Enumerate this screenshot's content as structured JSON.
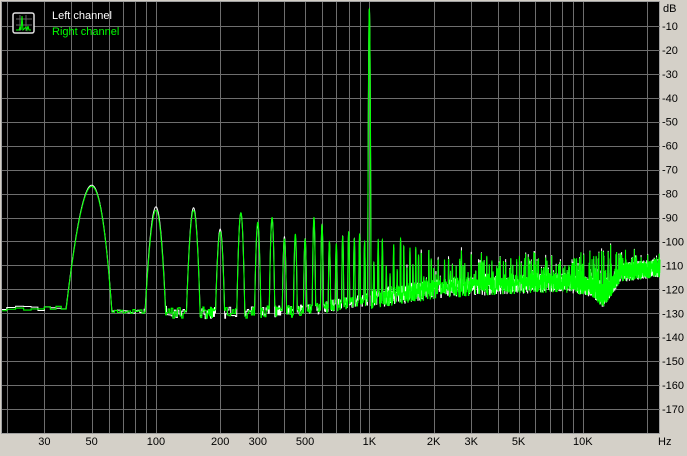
{
  "chart_data": {
    "type": "line",
    "title": "",
    "xlabel": "Hz",
    "ylabel": "dB",
    "xscale": "log",
    "xlim": [
      19,
      23000
    ],
    "ylim": [
      -180,
      0
    ],
    "grid": true,
    "legend_position": "top-left",
    "x_tick_labels": [
      {
        "value": 30,
        "label": "30"
      },
      {
        "value": 50,
        "label": "50"
      },
      {
        "value": 100,
        "label": "100"
      },
      {
        "value": 200,
        "label": "200"
      },
      {
        "value": 300,
        "label": "300"
      },
      {
        "value": 500,
        "label": "500"
      },
      {
        "value": 1000,
        "label": "1K"
      },
      {
        "value": 2000,
        "label": "2K"
      },
      {
        "value": 3000,
        "label": "3K"
      },
      {
        "value": 5000,
        "label": "5K"
      },
      {
        "value": 10000,
        "label": "10K"
      }
    ],
    "y_tick_labels": [
      {
        "value": -10,
        "label": "-10"
      },
      {
        "value": -20,
        "label": "-20"
      },
      {
        "value": -30,
        "label": "-30"
      },
      {
        "value": -40,
        "label": "-40"
      },
      {
        "value": -50,
        "label": "-50"
      },
      {
        "value": -60,
        "label": "-60"
      },
      {
        "value": -70,
        "label": "-70"
      },
      {
        "value": -80,
        "label": "-80"
      },
      {
        "value": -90,
        "label": "-90"
      },
      {
        "value": -100,
        "label": "-100"
      },
      {
        "value": -110,
        "label": "-110"
      },
      {
        "value": -120,
        "label": "-120"
      },
      {
        "value": -130,
        "label": "-130"
      },
      {
        "value": -140,
        "label": "-140"
      },
      {
        "value": -150,
        "label": "-150"
      },
      {
        "value": -160,
        "label": "-160"
      },
      {
        "value": -170,
        "label": "-170"
      }
    ],
    "fundamental": {
      "freq": 1000,
      "level": -3
    },
    "harmonic_spacing_hz": 50,
    "harmonic_peaks": [
      [
        50,
        -77
      ],
      [
        100,
        -87
      ],
      [
        150,
        -87
      ],
      [
        200,
        -96
      ],
      [
        250,
        -88
      ],
      [
        300,
        -92
      ],
      [
        350,
        -90
      ],
      [
        400,
        -99
      ],
      [
        450,
        -97
      ],
      [
        500,
        -99
      ],
      [
        550,
        -90
      ],
      [
        600,
        -93
      ],
      [
        650,
        -100
      ],
      [
        700,
        -101
      ],
      [
        750,
        -98
      ],
      [
        800,
        -96
      ],
      [
        850,
        -99
      ],
      [
        900,
        -97
      ],
      [
        950,
        -100
      ]
    ],
    "harmonic_envelope_above_1k": [
      [
        1050,
        -100
      ],
      [
        2000,
        -106
      ],
      [
        3000,
        -108
      ],
      [
        5000,
        -108
      ],
      [
        8000,
        -108
      ],
      [
        10000,
        -106
      ],
      [
        15000,
        -104
      ],
      [
        23000,
        -108
      ]
    ],
    "noise_floor": [
      [
        19,
        -128
      ],
      [
        40,
        -128
      ],
      [
        60,
        -129
      ],
      [
        200,
        -130
      ],
      [
        500,
        -129
      ],
      [
        1000,
        -124
      ],
      [
        2000,
        -120
      ],
      [
        4000,
        -118
      ],
      [
        8000,
        -117
      ],
      [
        11000,
        -119
      ],
      [
        12500,
        -124
      ],
      [
        15000,
        -113
      ],
      [
        23000,
        -111
      ]
    ],
    "series": [
      {
        "name": "Left channel",
        "color": "#ffffff"
      },
      {
        "name": "Right channel",
        "color": "#00ff00"
      }
    ]
  }
}
